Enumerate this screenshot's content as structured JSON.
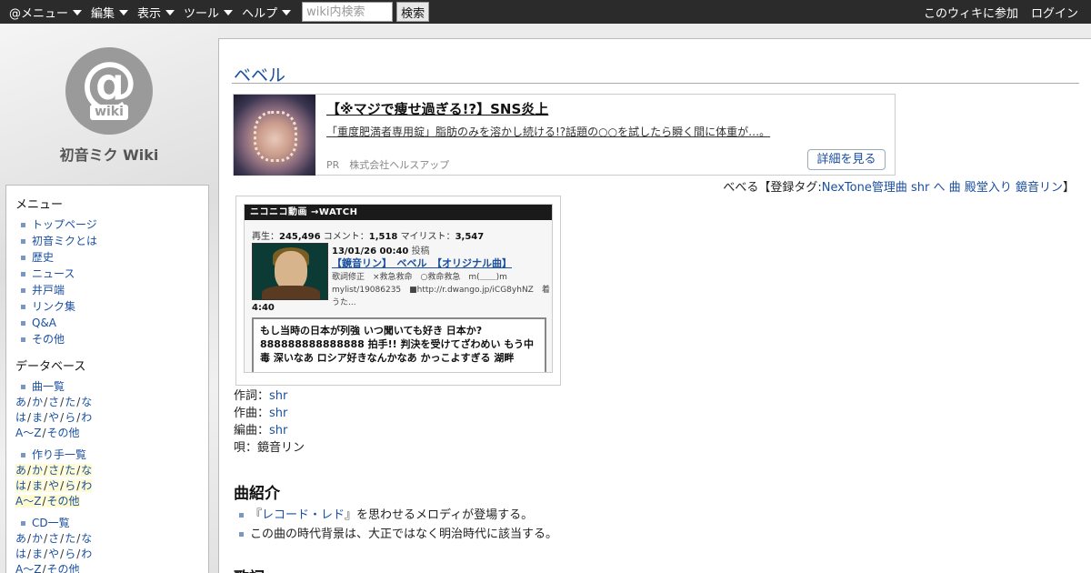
{
  "topbar": {
    "menus": [
      {
        "label": "@メニュー"
      },
      {
        "label": "編集"
      },
      {
        "label": "表示"
      },
      {
        "label": "ツール"
      },
      {
        "label": "ヘルプ"
      }
    ],
    "search_placeholder": "wiki内検索",
    "search_button": "検索",
    "join": "このウィキに参加",
    "login": "ログイン"
  },
  "site": {
    "logo_mark": "@",
    "logo_word": "wiki",
    "title": "初音ミク Wiki"
  },
  "sidebar": {
    "menu_heading": "メニュー",
    "menu_items": [
      "トップページ",
      "初音ミクとは",
      "歴史",
      "ニュース",
      "井戸端",
      "リンク集",
      "Q&A",
      "その他"
    ],
    "db_heading": "データベース",
    "songs_label": "曲一覧",
    "creators_label": "作り手一覧",
    "cd_label": "CD一覧",
    "kana_rows": [
      [
        "あ",
        "か",
        "さ",
        "た",
        "な"
      ],
      [
        "は",
        "ま",
        "や",
        "ら",
        "わ"
      ],
      [
        "A～Z",
        "その他"
      ]
    ],
    "separator": "/"
  },
  "page": {
    "title": "ベベル"
  },
  "ad": {
    "headline": "【※マジで痩せ過ぎる!?】SNS炎上",
    "description": "「重度肥満者専用錠」脂肪のみを溶かし続ける!?話題の○○を試したら瞬く間に体重が…。",
    "meta": "PR　株式会社ヘルスアップ",
    "button": "詳細を見る"
  },
  "tags": {
    "prefix": "べべる【登録タグ:",
    "items": [
      "NexTone管理曲",
      "shr",
      "へ",
      "曲",
      "殿堂入り",
      "鏡音リン"
    ],
    "suffix": "】"
  },
  "nico": {
    "bar_label": "ニコニコ動画 →WATCH",
    "views_label": "再生：",
    "views": "245,496",
    "comments_label": "コメント：",
    "comments": "1,518",
    "mylist_label": "マイリスト：",
    "mylist": "3,547",
    "date": "13/01/26 00:40",
    "date_suffix": "投稿",
    "video_title": "【鏡音リン】　ベベル　【オリジナル曲】",
    "video_desc": "歌詞修正　×救急救命　○救命救急　m(＿＿)m mylist/19086235　■http://r.dwango.jp/iCG8yhNZ　着うた...",
    "length": "4:40",
    "comment_text": "もし当時の日本が列強 いつ聞いても好き 日本か? 888888888888888 拍手!! 判決を受けてざわめい もう中毒 深いなあ ロシア好きなんかなあ かっこよすぎる 湖畔"
  },
  "credits": [
    {
      "role": "作詞：",
      "name": "shr",
      "linked": true
    },
    {
      "role": "作曲：",
      "name": "shr",
      "linked": true
    },
    {
      "role": "編曲：",
      "name": "shr",
      "linked": true
    },
    {
      "role": "唄：",
      "name": "鏡音リン",
      "linked": false
    }
  ],
  "intro": {
    "heading": "曲紹介",
    "items": [
      {
        "pre": "『",
        "link": "レコード・レド",
        "post": "』を思わせるメロディが登場する。"
      },
      {
        "pre": "",
        "link": "",
        "post": "この曲の時代背景は、大正ではなく明治時代に該当する。"
      }
    ]
  },
  "lyrics": {
    "heading": "歌詞"
  }
}
